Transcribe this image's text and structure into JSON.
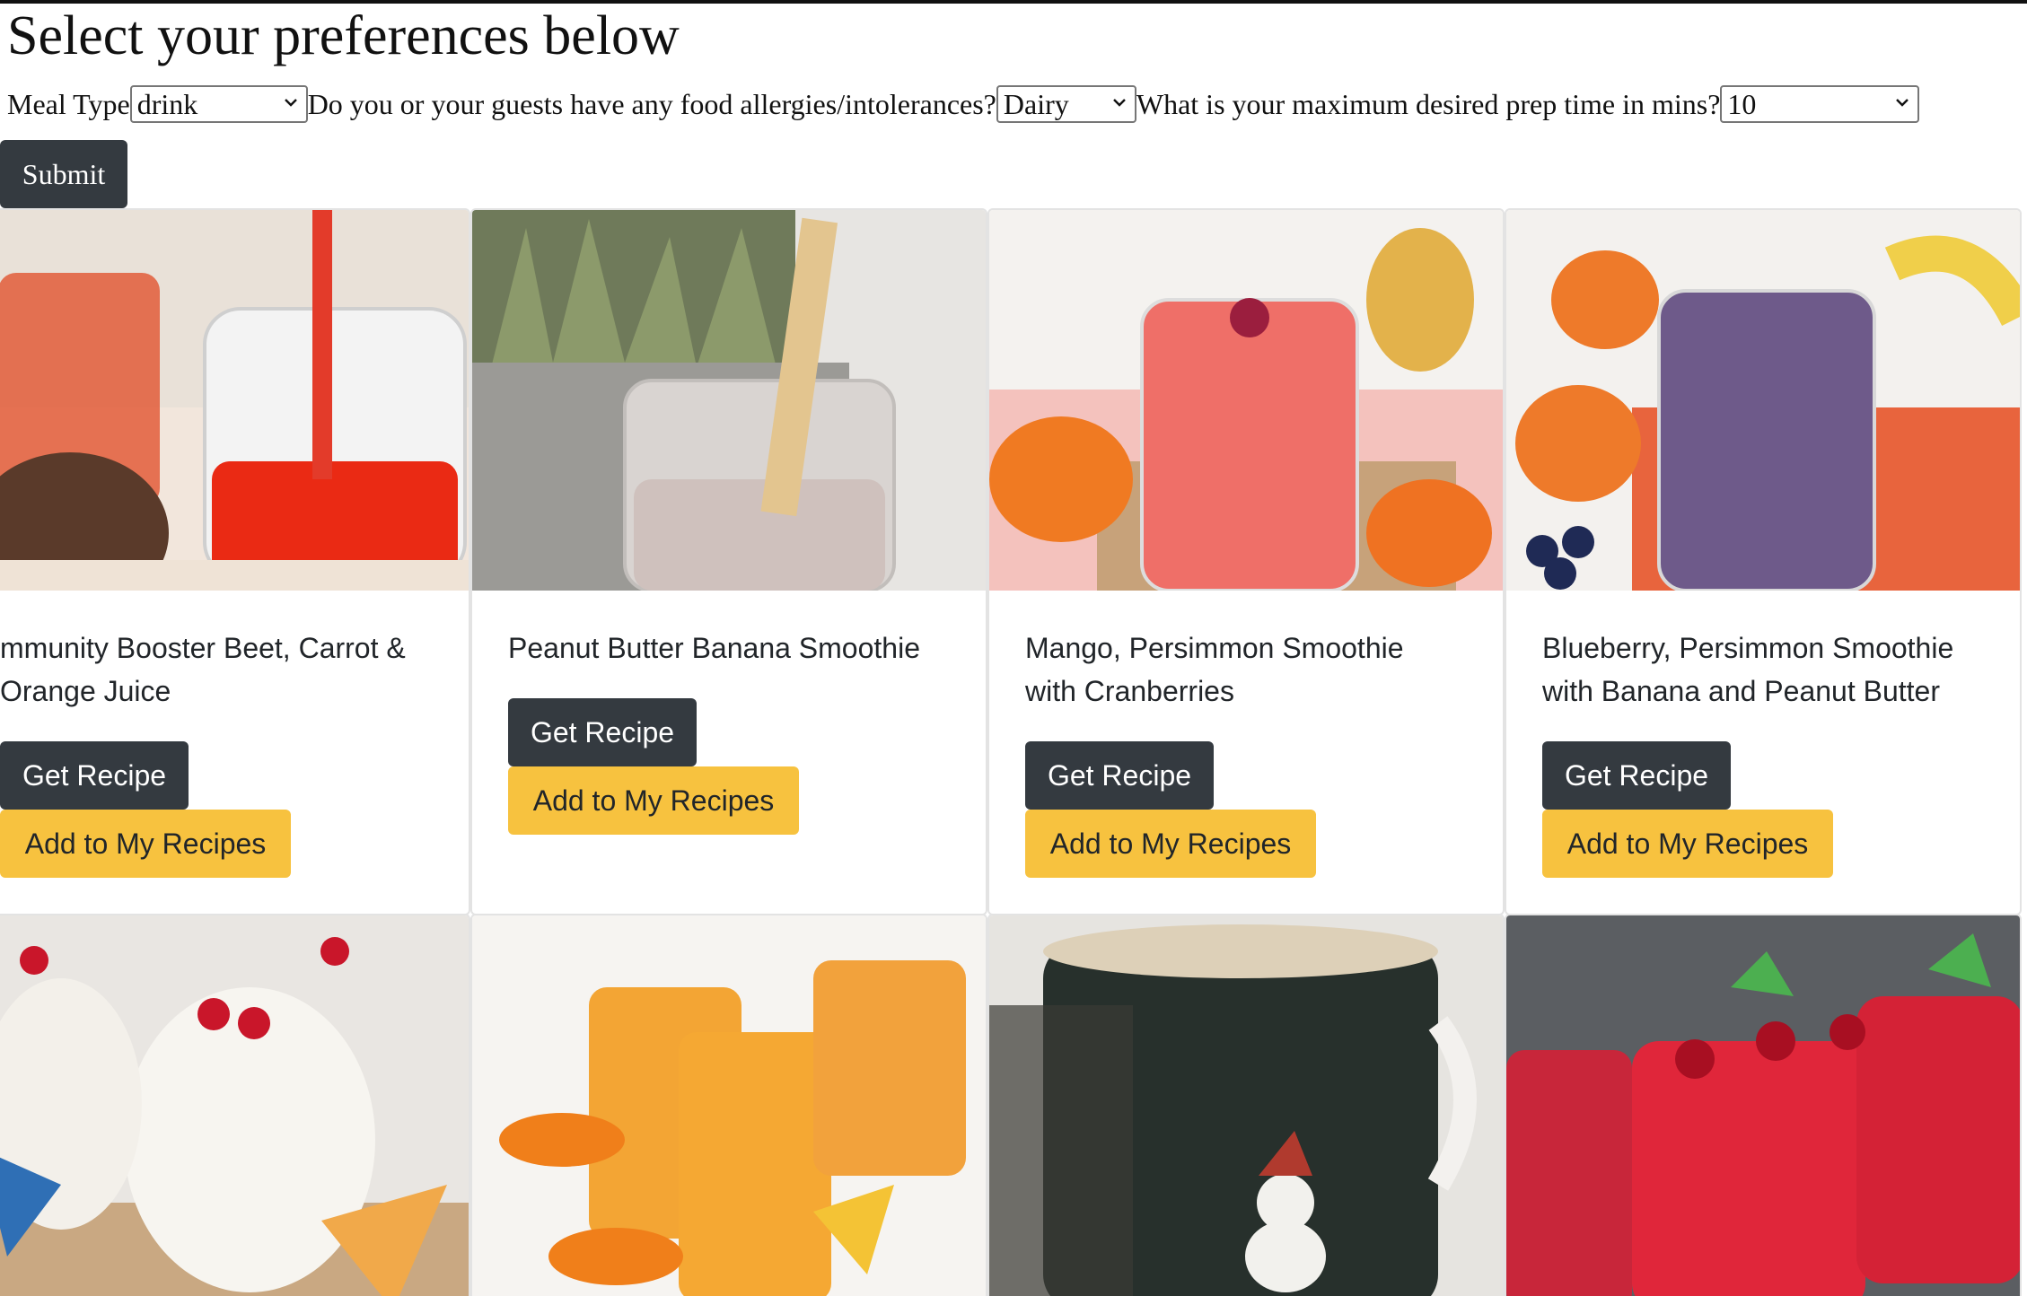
{
  "heading": "Select your preferences below",
  "form": {
    "meal_type_label": "Meal Type",
    "meal_type_value": "drink",
    "allergies_label": "Do you or your guests have any food allergies/intolerances?",
    "allergies_value": "Dairy",
    "prep_time_label": "What is your maximum desired prep time in mins?",
    "prep_time_value": "10",
    "submit_label": "Submit"
  },
  "buttons": {
    "get_recipe": "Get Recipe",
    "add_to_my_recipes": "Add to My Recipes"
  },
  "recipes": [
    {
      "title_line1": "mmunity Booster Beet, Carrot &",
      "title_line2": "Orange Juice",
      "image": "beet-carrot-orange-juice-photo"
    },
    {
      "title_line1": "Peanut Butter Banana Smoothie",
      "title_line2": "",
      "image": "peanut-butter-banana-smoothie-photo"
    },
    {
      "title_line1": "Mango, Persimmon Smoothie",
      "title_line2": "with Cranberries",
      "image": "mango-persimmon-smoothie-photo"
    },
    {
      "title_line1": "Blueberry, Persimmon Smoothie",
      "title_line2": "with Banana and Peanut Butter",
      "image": "blueberry-persimmon-smoothie-photo"
    },
    {
      "image": "pina-colada-drinks-photo"
    },
    {
      "image": "orange-pineapple-punch-photo"
    },
    {
      "image": "holiday-latte-mug-photo"
    },
    {
      "image": "cranberry-spritzer-photo"
    }
  ],
  "colors": {
    "dark_button": "#343a40",
    "warning_button": "#f7c23f"
  }
}
